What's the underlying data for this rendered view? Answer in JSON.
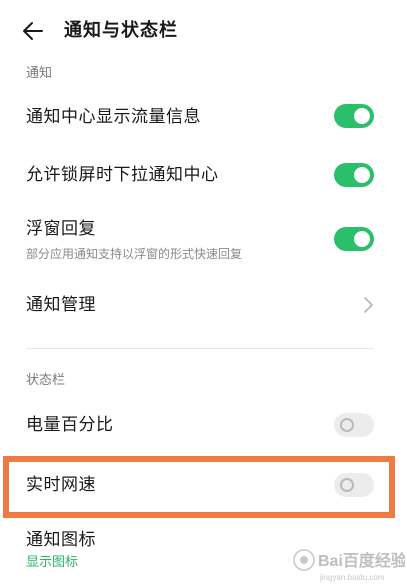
{
  "header": {
    "title": "通知与状态栏"
  },
  "sections": {
    "notification_label": "通知",
    "statusbar_label": "状态栏"
  },
  "rows": {
    "traffic_info": {
      "title": "通知中心显示流量信息",
      "toggle": "on"
    },
    "lockscreen_pull": {
      "title": "允许锁屏时下拉通知中心",
      "toggle": "on"
    },
    "float_reply": {
      "title": "浮窗回复",
      "subtitle": "部分应用通知支持以浮窗的形式快速回复",
      "toggle": "on"
    },
    "notif_manage": {
      "title": "通知管理"
    },
    "battery_percent": {
      "title": "电量百分比",
      "toggle": "off"
    },
    "realtime_speed": {
      "title": "实时网速",
      "toggle": "off"
    },
    "notif_icons": {
      "title": "通知图标",
      "value": "显示图标"
    }
  },
  "colors": {
    "toggle_on": "#2bbf6b",
    "toggle_off": "#ececec",
    "highlight": "#ee7a45",
    "accent_text": "#25b767"
  },
  "watermark": {
    "text": "Bai百度经验",
    "sub": "jingyan.baidu.com"
  }
}
